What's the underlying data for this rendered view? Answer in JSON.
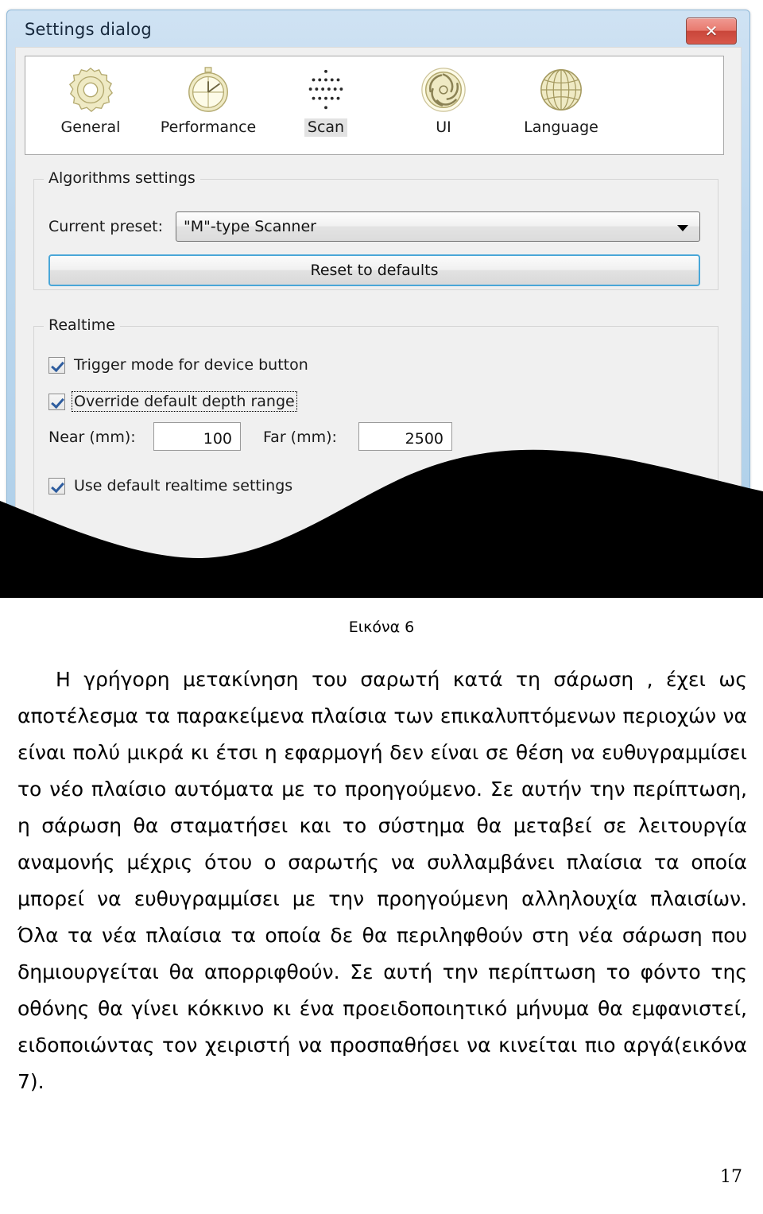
{
  "window": {
    "title": "Settings dialog",
    "close_label": "✕",
    "close_icon": "close-icon"
  },
  "toolbar": {
    "items": [
      {
        "label": "General",
        "icon": "gear-icon",
        "selected": false
      },
      {
        "label": "Performance",
        "icon": "stopwatch-icon",
        "selected": false
      },
      {
        "label": "Scan",
        "icon": "dot-grid-icon",
        "selected": true
      },
      {
        "label": "UI",
        "icon": "aperture-icon",
        "selected": false
      },
      {
        "label": "Language",
        "icon": "globe-icon",
        "selected": false
      }
    ]
  },
  "algorithms_group": {
    "title": "Algorithms settings",
    "preset_label": "Current preset:",
    "preset_value": "\"M\"-type Scanner",
    "preset_options": [
      "\"M\"-type Scanner"
    ],
    "reset_button": "Reset to defaults"
  },
  "realtime_group": {
    "title": "Realtime",
    "trigger_mode": "Trigger mode for device button",
    "override_depth": "Override default depth range",
    "near_label": "Near (mm):",
    "near_value": "100",
    "far_label": "Far (mm):",
    "far_value": "2500",
    "use_defaults": "Use default realtime settings"
  },
  "document": {
    "figure_caption": "Εικόνα 6",
    "paragraph": "Η γρήγορη μετακίνηση του σαρωτή κατά τη σάρωση , έχει ως αποτέλεσμα τα παρακείμενα πλαίσια των επικαλυπτόμενων περιοχών να είναι πολύ μικρά κι έτσι η εφαρμογή δεν είναι σε θέση να ευθυγραμμίσει το νέο πλαίσιο αυτόματα με το προηγούμενο. Σε αυτήν την περίπτωση, η σάρωση θα σταματήσει και το σύστημα θα μεταβεί σε λειτουργία αναμονής μέχρις ότου ο σαρωτής να συλλαμβάνει πλαίσια τα οποία μπορεί να ευθυγραμμίσει με την προηγούμενη αλληλουχία πλαισίων. Όλα τα νέα πλαίσια τα οποία δε θα περιληφθούν στη νέα σάρωση που δημιουργείται θα απορριφθούν. Σε αυτή την περίπτωση το φόντο της οθόνης θα γίνει κόκκινο κι ένα προειδοποιητικό μήνυμα θα εμφανιστεί, ειδοποιώντας τον χειριστή  να προσπαθήσει να κινείται πιο αργά(εικόνα 7).",
    "page_number": "17"
  },
  "colors": {
    "title_bar": "#bcd7ee",
    "close_red": "#c9463a",
    "focus_blue": "#4aa7d8",
    "icon_gold": "#c9bd84",
    "wave_black": "#000000"
  }
}
